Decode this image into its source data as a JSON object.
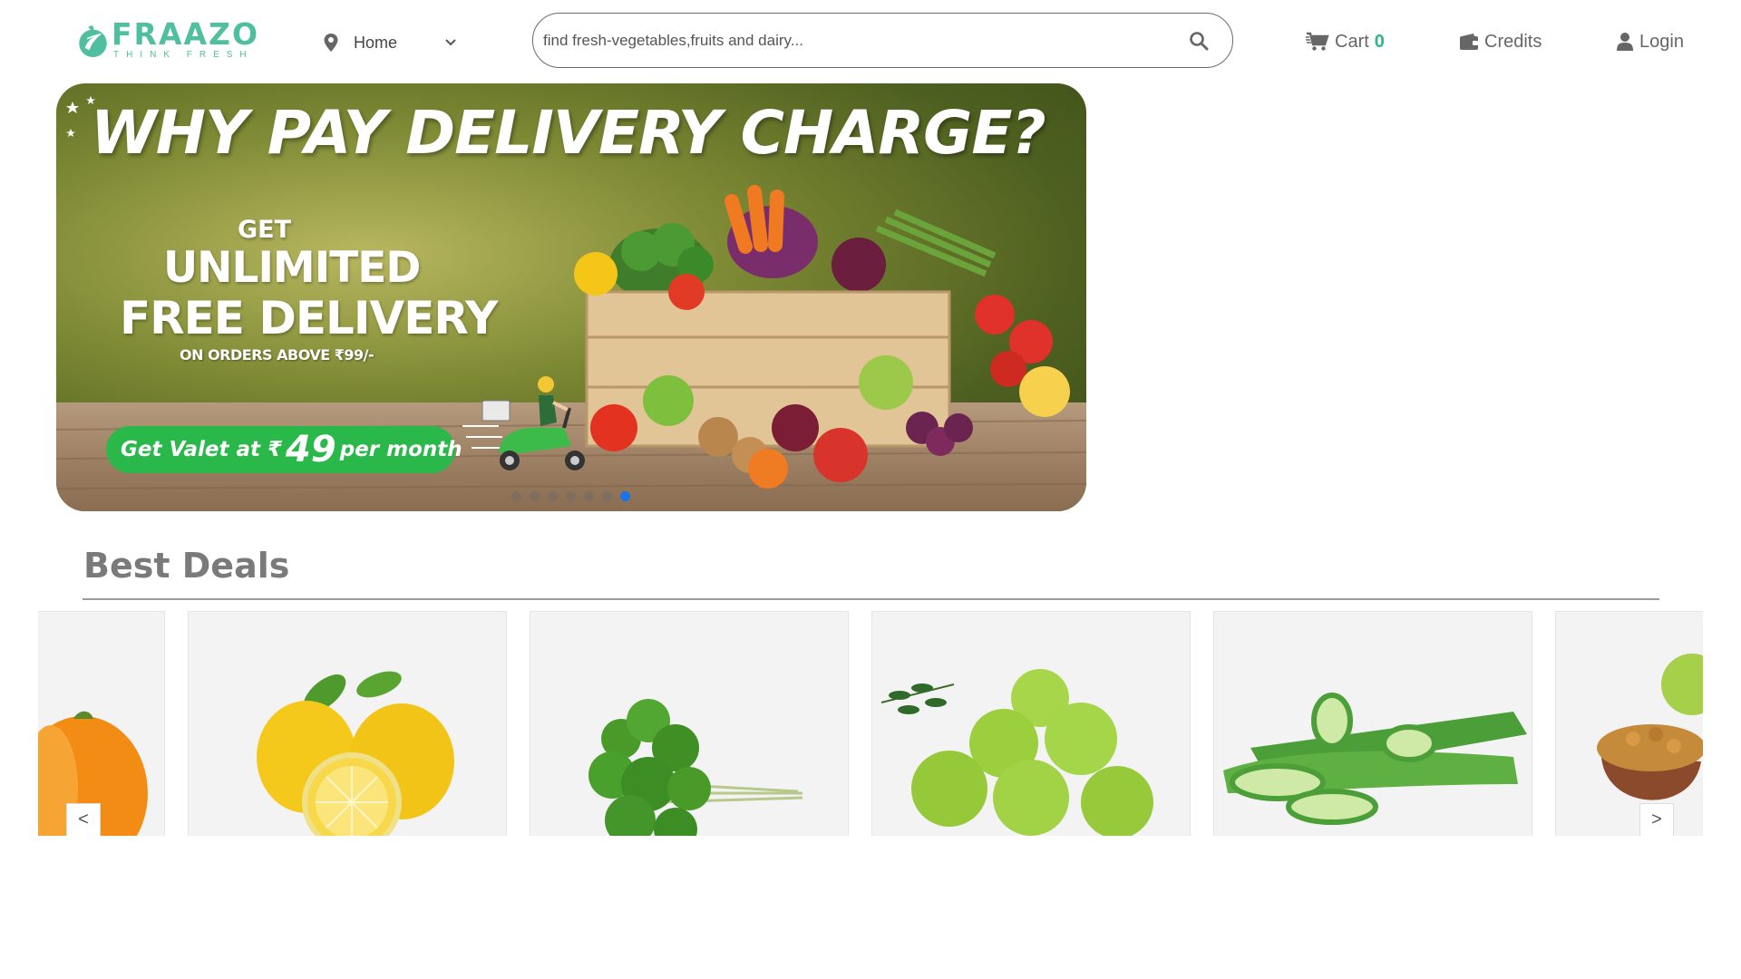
{
  "brand": {
    "name": "FRAAZO",
    "tagline": "THINK FRESH",
    "accent": "#4fbf9f"
  },
  "location": {
    "label": "Home",
    "icon": "map-pin-icon"
  },
  "search": {
    "placeholder": "find fresh-vegetables,fruits and dairy...",
    "icon": "search-icon"
  },
  "nav": {
    "cart_label": "Cart",
    "cart_count": "0",
    "credits_label": "Credits",
    "login_label": "Login"
  },
  "banner": {
    "headline": "WHY PAY DELIVERY CHARGE?",
    "line_get": "GET",
    "line_unlimited": "UNLIMITED",
    "line_free": "FREE DELIVERY",
    "line_min": "ON ORDERS ABOVE ₹99/-",
    "valet_prefix": "Get Valet at ₹",
    "valet_price": "49",
    "valet_suffix": "per month",
    "slide_count": 7,
    "active_slide": 7
  },
  "deals": {
    "title": "Best Deals",
    "items": [
      {
        "name": "yellow-bell-pepper"
      },
      {
        "name": "lemon"
      },
      {
        "name": "coriander"
      },
      {
        "name": "amla"
      },
      {
        "name": "aloe-vera"
      },
      {
        "name": "dry-fruits"
      }
    ],
    "prev_label": "<",
    "next_label": ">"
  }
}
